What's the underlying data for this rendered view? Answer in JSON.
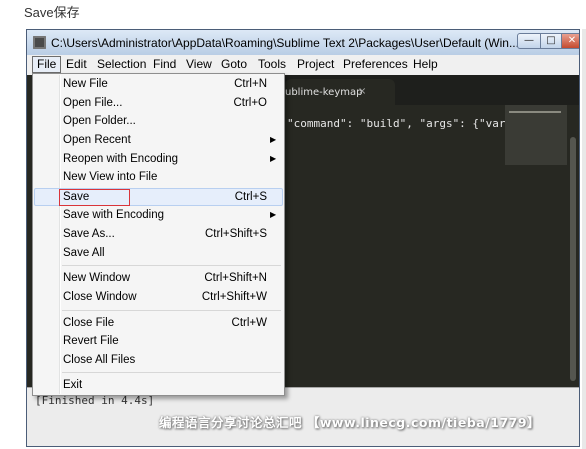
{
  "page_heading": "Save保存",
  "window": {
    "title": "C:\\Users\\Administrator\\AppData\\Roaming\\Sublime Text 2\\Packages\\User\\Default (Win...",
    "controls": {
      "minimize": "—",
      "maximize": "□",
      "close": "✕"
    }
  },
  "menubar": [
    "File",
    "Edit",
    "Selection",
    "Find",
    "View",
    "Goto",
    "Tools",
    "Project",
    "Preferences",
    "Help"
  ],
  "editor": {
    "tab_label": "ublime-keymap",
    "tab_close": "×",
    "code_line": "\"command\": \"build\", \"args\": {\"variant"
  },
  "console_output": "[Finished in 4.4s]",
  "watermark": "编程语言分享讨论总汇吧 【www.linecg.com/tieba/1779】",
  "file_menu": [
    {
      "label": "New File",
      "shortcut": "Ctrl+N"
    },
    {
      "label": "Open File...",
      "shortcut": "Ctrl+O"
    },
    {
      "label": "Open Folder...",
      "shortcut": ""
    },
    {
      "label": "Open Recent",
      "shortcut": "",
      "submenu": true
    },
    {
      "label": "Reopen with Encoding",
      "shortcut": "",
      "submenu": true
    },
    {
      "label": "New View into File",
      "shortcut": ""
    },
    {
      "label": "Save",
      "shortcut": "Ctrl+S",
      "highlighted": true
    },
    {
      "label": "Save with Encoding",
      "shortcut": "",
      "submenu": true
    },
    {
      "label": "Save As...",
      "shortcut": "Ctrl+Shift+S"
    },
    {
      "label": "Save All",
      "shortcut": ""
    },
    {
      "label": "New Window",
      "shortcut": "Ctrl+Shift+N"
    },
    {
      "label": "Close Window",
      "shortcut": "Ctrl+Shift+W"
    },
    {
      "label": "Close File",
      "shortcut": "Ctrl+W"
    },
    {
      "label": "Revert File",
      "shortcut": ""
    },
    {
      "label": "Close All Files",
      "shortcut": ""
    },
    {
      "label": "Exit",
      "shortcut": ""
    }
  ],
  "colors": {
    "editor_bg": "#272822",
    "highlight_box": "#d9343a",
    "menu_bg": "#f5f5f5"
  }
}
